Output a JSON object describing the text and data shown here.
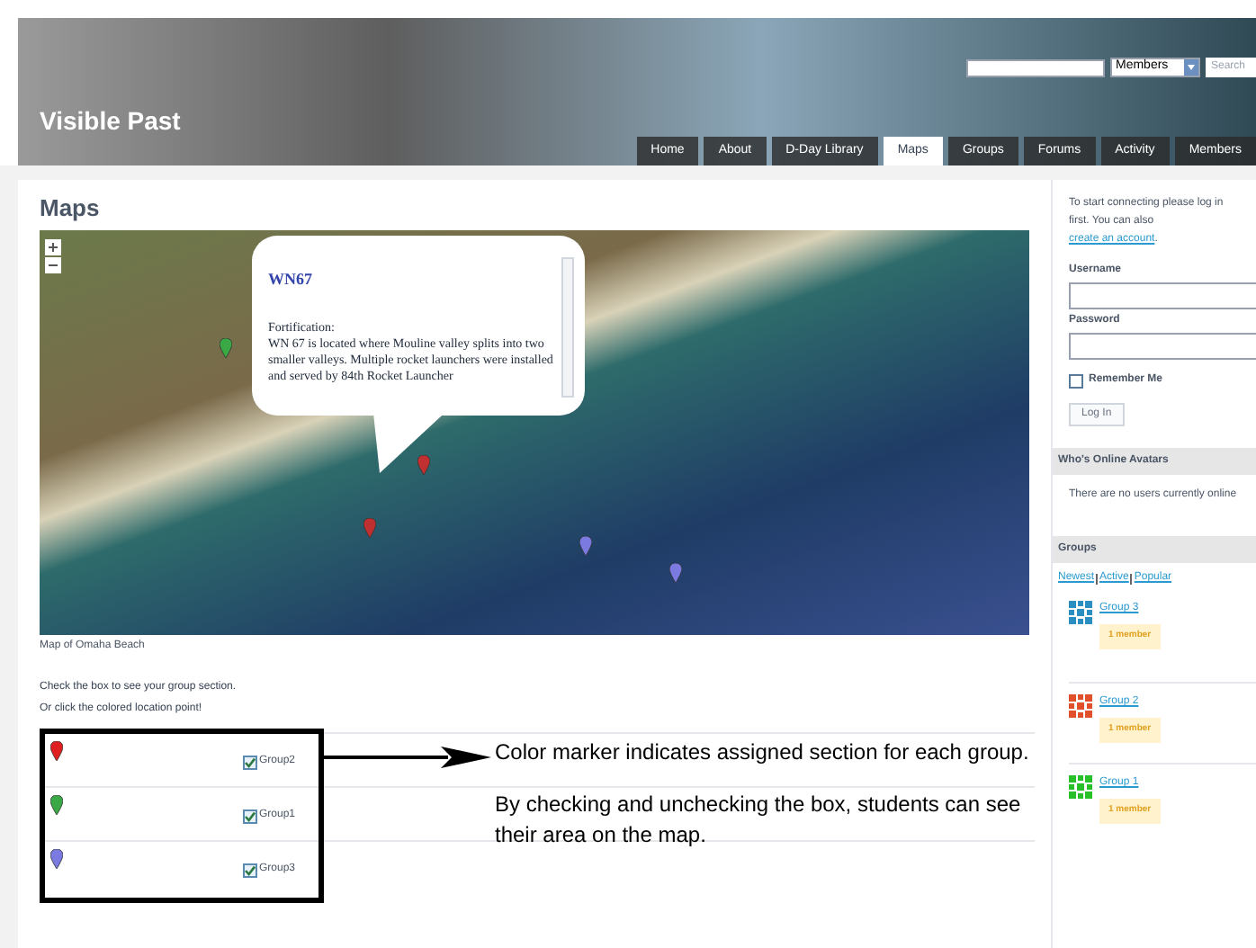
{
  "header": {
    "site_title": "Visible Past",
    "search": {
      "select": "Members",
      "button": "Search"
    },
    "nav": [
      {
        "label": "Home",
        "selected": false
      },
      {
        "label": "About",
        "selected": false
      },
      {
        "label": "D-Day Library",
        "selected": false
      },
      {
        "label": "Maps",
        "selected": true
      },
      {
        "label": "Groups",
        "selected": false
      },
      {
        "label": "Forums",
        "selected": false
      },
      {
        "label": "Activity",
        "selected": false
      },
      {
        "label": "Members",
        "selected": false
      }
    ]
  },
  "main": {
    "title": "Maps",
    "map": {
      "popup": {
        "title": "WN67",
        "heading": "Fortification:",
        "body": "WN 67 is located where Mouline valley splits into two smaller valleys. Multiple rocket launchers were installed and served by 84th Rocket Launcher"
      },
      "caption": "Map of Omaha Beach"
    },
    "instructions": [
      "Check the box to see your group section.",
      "Or click the colored location point!"
    ],
    "group_rows": [
      {
        "color": "#e02020",
        "checked": true,
        "label": "Group2"
      },
      {
        "color": "#3aa845",
        "checked": true,
        "label": "Group1"
      },
      {
        "color": "#7a7ae0",
        "checked": true,
        "label": "Group3"
      }
    ],
    "annotation": [
      "Color marker indicates assigned section for each group.",
      "By checking and unchecking the box, students can see their area on the map."
    ]
  },
  "sidebar": {
    "login": {
      "intro": "To start connecting please log in first. You can also",
      "link": "create an account",
      "end": ".",
      "username_label": "Username",
      "password_label": "Password",
      "remember": {
        "label": "Remember Me",
        "checked": false
      },
      "button": "Log In"
    },
    "online": {
      "title": "Who's Online Avatars",
      "text": "There are no users currently online"
    },
    "groups": {
      "title": "Groups",
      "filters": [
        "Newest",
        "Active",
        "Popular"
      ],
      "items": [
        {
          "name": "Group 3",
          "count": "1 member",
          "color": "#2a8fc0"
        },
        {
          "name": "Group 2",
          "count": "1 member",
          "color": "#e0502a"
        },
        {
          "name": "Group 1",
          "count": "1 member",
          "color": "#28c028"
        }
      ]
    }
  }
}
